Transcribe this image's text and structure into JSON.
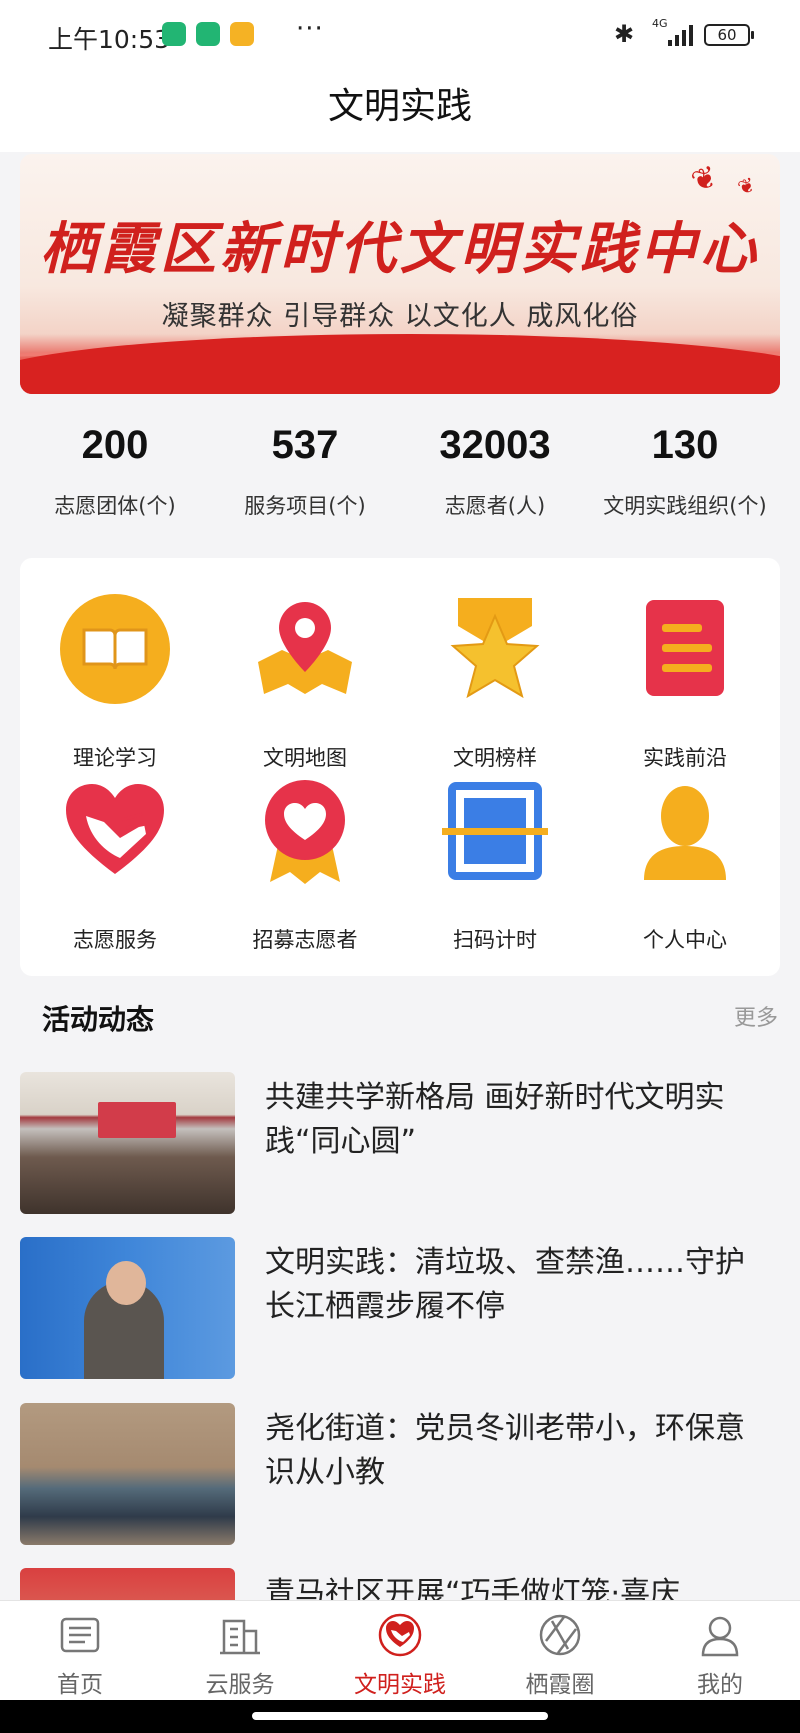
{
  "status_bar": {
    "time": "上午10:53",
    "dots": "···",
    "network": "4G",
    "battery": "60"
  },
  "header": {
    "title": "文明实践"
  },
  "banner": {
    "title": "栖霞区新时代文明实践中心",
    "subtitle": "凝聚群众 引导群众 以文化人 成风化俗"
  },
  "stats": [
    {
      "value": "200",
      "label": "志愿团体(个)"
    },
    {
      "value": "537",
      "label": "服务项目(个)"
    },
    {
      "value": "32003",
      "label": "志愿者(人)"
    },
    {
      "value": "130",
      "label": "文明实践组织(个)"
    }
  ],
  "grid": [
    {
      "label": "理论学习",
      "icon": "book-icon"
    },
    {
      "label": "文明地图",
      "icon": "map-pin-icon"
    },
    {
      "label": "文明榜样",
      "icon": "star-medal-icon"
    },
    {
      "label": "实践前沿",
      "icon": "document-icon"
    },
    {
      "label": "志愿服务",
      "icon": "heart-hand-icon"
    },
    {
      "label": "招募志愿者",
      "icon": "heart-badge-icon"
    },
    {
      "label": "扫码计时",
      "icon": "scan-icon"
    },
    {
      "label": "个人中心",
      "icon": "person-icon"
    }
  ],
  "activities": {
    "title": "活动动态",
    "more": "更多",
    "items": [
      {
        "title": "共建共学新格局 画好新时代文明实践“同心圆”"
      },
      {
        "title": "文明实践：清垃圾、查禁渔……守护长江栖霞步履不停"
      },
      {
        "title": "尧化街道：党员冬训老带小，环保意识从小教"
      },
      {
        "title": "青马社区开展“巧手做灯笼·喜庆"
      }
    ]
  },
  "tabs": [
    {
      "label": "首页",
      "icon": "news-icon"
    },
    {
      "label": "云服务",
      "icon": "building-icon"
    },
    {
      "label": "文明实践",
      "icon": "heart-hand-icon"
    },
    {
      "label": "栖霞圈",
      "icon": "aperture-icon"
    },
    {
      "label": "我的",
      "icon": "user-icon"
    }
  ],
  "colors": {
    "accent": "#d0201d",
    "gold": "#f5ae1e"
  }
}
